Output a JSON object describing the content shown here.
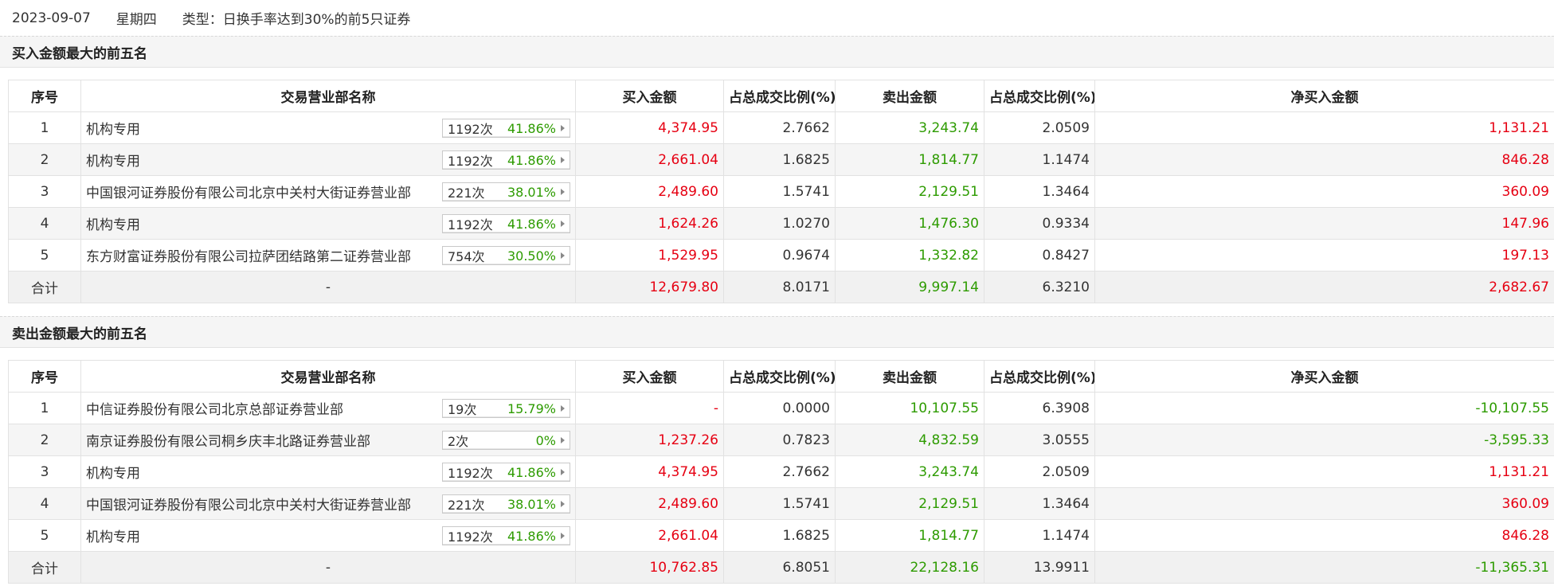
{
  "header": {
    "date": "2023-09-07",
    "weekday": "星期四",
    "type": "类型：日换手率达到30%的前5只证券"
  },
  "colors": {
    "positive": "#e60012",
    "negative": "#2d9b00"
  },
  "columns": [
    "序号",
    "交易营业部名称",
    "买入金额",
    "占总成交比例(%)",
    "卖出金额",
    "占总成交比例(%)",
    "净买入金额"
  ],
  "buy_section": {
    "title": "买入金额最大的前五名",
    "rows": [
      {
        "idx": "1",
        "name": "机构专用",
        "times": "1192次",
        "pct": "41.86%",
        "buy": "4,374.95",
        "buy_ratio": "2.7662",
        "sell": "3,243.74",
        "sell_ratio": "2.0509",
        "net": "1,131.21"
      },
      {
        "idx": "2",
        "name": "机构专用",
        "times": "1192次",
        "pct": "41.86%",
        "buy": "2,661.04",
        "buy_ratio": "1.6825",
        "sell": "1,814.77",
        "sell_ratio": "1.1474",
        "net": "846.28"
      },
      {
        "idx": "3",
        "name": "中国银河证券股份有限公司北京中关村大街证券营业部",
        "times": "221次",
        "pct": "38.01%",
        "buy": "2,489.60",
        "buy_ratio": "1.5741",
        "sell": "2,129.51",
        "sell_ratio": "1.3464",
        "net": "360.09"
      },
      {
        "idx": "4",
        "name": "机构专用",
        "times": "1192次",
        "pct": "41.86%",
        "buy": "1,624.26",
        "buy_ratio": "1.0270",
        "sell": "1,476.30",
        "sell_ratio": "0.9334",
        "net": "147.96"
      },
      {
        "idx": "5",
        "name": "东方财富证券股份有限公司拉萨团结路第二证券营业部",
        "times": "754次",
        "pct": "30.50%",
        "buy": "1,529.95",
        "buy_ratio": "0.9674",
        "sell": "1,332.82",
        "sell_ratio": "0.8427",
        "net": "197.13"
      }
    ],
    "total": {
      "label": "合计",
      "name": "-",
      "buy": "12,679.80",
      "buy_ratio": "8.0171",
      "sell": "9,997.14",
      "sell_ratio": "6.3210",
      "net": "2,682.67"
    }
  },
  "sell_section": {
    "title": "卖出金额最大的前五名",
    "rows": [
      {
        "idx": "1",
        "name": "中信证券股份有限公司北京总部证券营业部",
        "times": "19次",
        "pct": "15.79%",
        "buy": "-",
        "buy_ratio": "0.0000",
        "sell": "10,107.55",
        "sell_ratio": "6.3908",
        "net": "-10,107.55"
      },
      {
        "idx": "2",
        "name": "南京证券股份有限公司桐乡庆丰北路证券营业部",
        "times": "2次",
        "pct": "0%",
        "buy": "1,237.26",
        "buy_ratio": "0.7823",
        "sell": "4,832.59",
        "sell_ratio": "3.0555",
        "net": "-3,595.33"
      },
      {
        "idx": "3",
        "name": "机构专用",
        "times": "1192次",
        "pct": "41.86%",
        "buy": "4,374.95",
        "buy_ratio": "2.7662",
        "sell": "3,243.74",
        "sell_ratio": "2.0509",
        "net": "1,131.21"
      },
      {
        "idx": "4",
        "name": "中国银河证券股份有限公司北京中关村大街证券营业部",
        "times": "221次",
        "pct": "38.01%",
        "buy": "2,489.60",
        "buy_ratio": "1.5741",
        "sell": "2,129.51",
        "sell_ratio": "1.3464",
        "net": "360.09"
      },
      {
        "idx": "5",
        "name": "机构专用",
        "times": "1192次",
        "pct": "41.86%",
        "buy": "2,661.04",
        "buy_ratio": "1.6825",
        "sell": "1,814.77",
        "sell_ratio": "1.1474",
        "net": "846.28"
      }
    ],
    "total": {
      "label": "合计",
      "name": "-",
      "buy": "10,762.85",
      "buy_ratio": "6.8051",
      "sell": "22,128.16",
      "sell_ratio": "13.9911",
      "net": "-11,365.31"
    }
  }
}
